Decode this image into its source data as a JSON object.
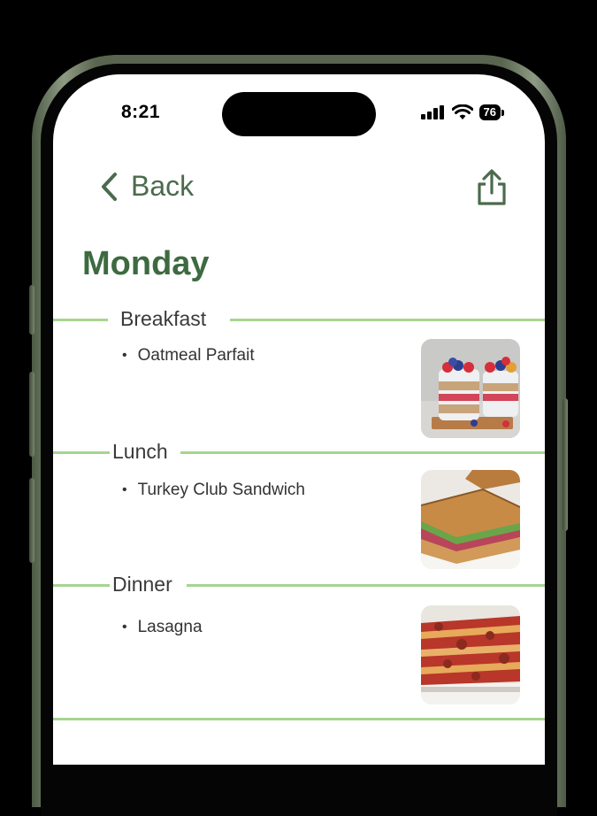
{
  "status_bar": {
    "time": "8:21",
    "battery": "76"
  },
  "nav": {
    "back_label": "Back"
  },
  "page": {
    "title": "Monday"
  },
  "meals": [
    {
      "label": "Breakfast",
      "items": [
        "Oatmeal Parfait"
      ]
    },
    {
      "label": "Lunch",
      "items": [
        "Turkey Club Sandwich"
      ]
    },
    {
      "label": "Dinner",
      "items": [
        "Lasagna"
      ]
    }
  ],
  "colors": {
    "accent": "#3d6a40",
    "divider": "#a6d591",
    "frame": "#59654f"
  }
}
